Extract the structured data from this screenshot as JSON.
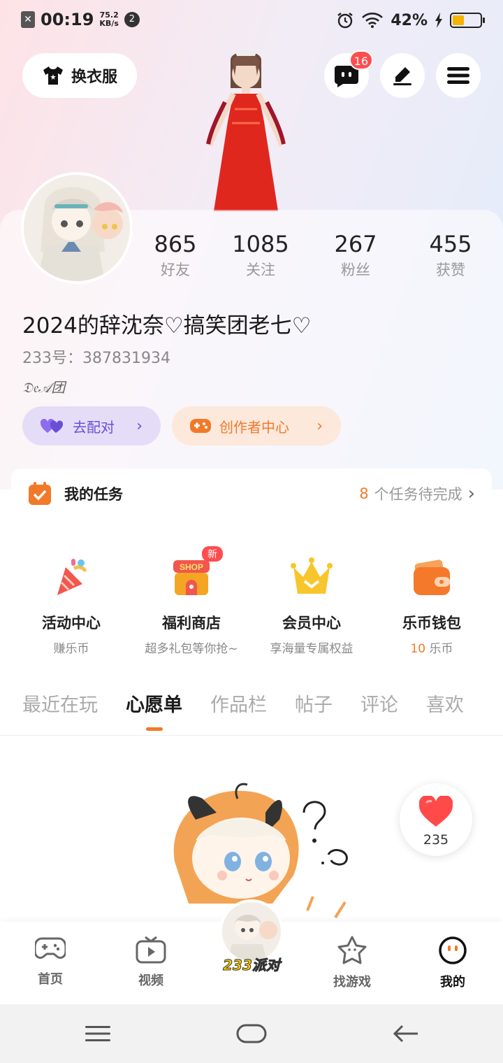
{
  "status_bar": {
    "time": "00:19",
    "speed_value": "75.2",
    "speed_unit": "KB/s",
    "notif_count": "2",
    "battery_percent": "42%",
    "battery_level": 0.42
  },
  "header": {
    "outfit_label": "换衣服",
    "message_badge": "16"
  },
  "profile": {
    "stats": [
      {
        "value": "865",
        "label": "好友"
      },
      {
        "value": "1085",
        "label": "关注"
      },
      {
        "value": "267",
        "label": "粉丝"
      },
      {
        "value": "455",
        "label": "获赞"
      }
    ],
    "nickname": "2024的辞沈奈♡搞笑团老七♡",
    "uid": "233号：387831934",
    "signature": "𝔇𝔢𝒜团",
    "match_label": "去配对",
    "creator_label": "创作者中心"
  },
  "tasks": {
    "title": "我的任务",
    "count": "8",
    "suffix": "个任务待完成"
  },
  "entries": [
    {
      "title": "活动中心",
      "sub": "赚乐币"
    },
    {
      "title": "福利商店",
      "sub": "超多礼包等你抢~",
      "badge": "新",
      "shop_text": "SHOP"
    },
    {
      "title": "会员中心",
      "sub": "享海量专属权益"
    },
    {
      "title": "乐币钱包",
      "sub_value": "10",
      "sub_unit": "乐币"
    }
  ],
  "tabs": [
    "最近在玩",
    "心愿单",
    "作品栏",
    "帖子",
    "评论",
    "喜欢"
  ],
  "active_tab": "心愿单",
  "likes": {
    "count": "235"
  },
  "bottom_nav": {
    "home": "首页",
    "video": "视频",
    "center": "233派对",
    "find": "找游戏",
    "mine": "我的"
  },
  "colors": {
    "accent": "#f07a2a",
    "badge_red": "#ff4d4f",
    "match_purple": "#6a4fd6"
  }
}
